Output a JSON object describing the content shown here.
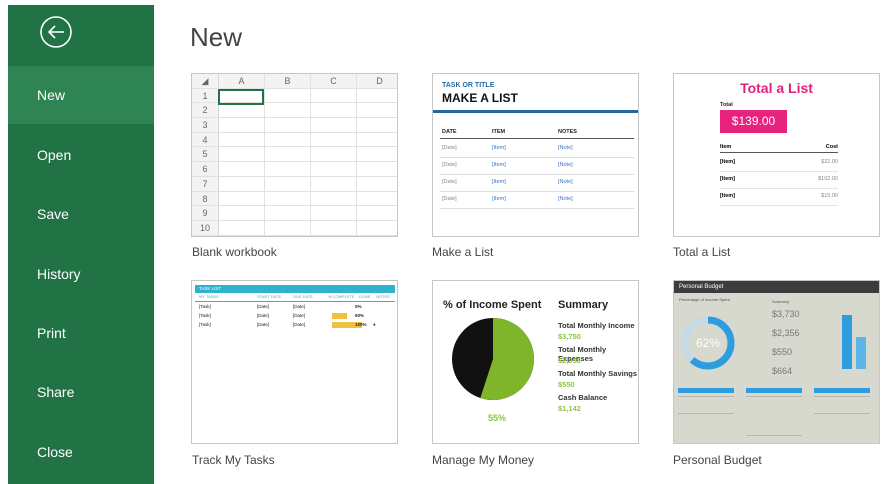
{
  "sidebar": {
    "back_label": "Back",
    "items": [
      {
        "label": "New",
        "active": true
      },
      {
        "label": "Open"
      },
      {
        "label": "Save"
      },
      {
        "label": "History"
      },
      {
        "label": "Print"
      },
      {
        "label": "Share"
      },
      {
        "label": "Close"
      }
    ],
    "colors": {
      "background": "#217346",
      "active": "#2f8454"
    }
  },
  "main": {
    "title": "New",
    "templates": [
      {
        "label": "Blank workbook"
      },
      {
        "label": "Make a List"
      },
      {
        "label": "Total a List"
      },
      {
        "label": "Track My Tasks"
      },
      {
        "label": "Manage My Money"
      },
      {
        "label": "Personal Budget"
      }
    ]
  },
  "blank_workbook": {
    "columns": [
      "A",
      "B",
      "C",
      "D"
    ],
    "rows": [
      "1",
      "2",
      "3",
      "4",
      "5",
      "6",
      "7",
      "8",
      "9",
      "10"
    ]
  },
  "make_a_list": {
    "eyebrow": "TASK OR TITLE",
    "heading": "MAKE A LIST",
    "columns": [
      "DATE",
      "ITEM",
      "NOTES"
    ],
    "rows": [
      [
        "[Date]",
        "[Item]",
        "[Note]"
      ],
      [
        "[Date]",
        "[Item]",
        "[Note]"
      ],
      [
        "[Date]",
        "[Item]",
        "[Note]"
      ],
      [
        "[Date]",
        "[Item]",
        "[Note]"
      ]
    ]
  },
  "total_a_list": {
    "heading": "Total a List",
    "total_label": "Total",
    "total_value": "$139.00",
    "columns": [
      "Item",
      "Cost"
    ],
    "rows": [
      [
        "[Item]",
        "$22.00"
      ],
      [
        "[Item]",
        "$102.00"
      ],
      [
        "[Item]",
        "$15.00"
      ]
    ]
  },
  "track_tasks": {
    "band": "TASK LIST",
    "headers": [
      "MY TASKS",
      "START DATE",
      "DUE DATE",
      "% COMPLETE",
      "DONE",
      "NOTES"
    ],
    "rows": [
      {
        "task": "[Task]",
        "start": "[Date]",
        "due": "[Date]",
        "pct": "0%",
        "fill": 0.0
      },
      {
        "task": "[Task]",
        "start": "[Date]",
        "due": "[Date]",
        "pct": "50%",
        "fill": 0.5
      },
      {
        "task": "[Task]",
        "start": "[Date]",
        "due": "[Date]",
        "pct": "100%",
        "fill": 1.0
      }
    ]
  },
  "manage_money": {
    "chart_title": "% of Income Spent",
    "pie_label": "55%",
    "spent_fraction": 0.55,
    "summary_title": "Summary",
    "lines": [
      {
        "label": "Total Monthly Income",
        "value": "$3,750"
      },
      {
        "label": "Total Monthly Expenses",
        "value": "$2,058"
      },
      {
        "label": "Total Monthly Savings",
        "value": "$550"
      },
      {
        "label": "Cash Balance",
        "value": "$1,142"
      }
    ]
  },
  "personal_budget": {
    "heading": "Personal Budget",
    "subheading": "Percentage of Income Spent",
    "donut_label": "62%",
    "donut_fraction": 0.62,
    "summary_title": "Summary",
    "values": [
      "$3,730",
      "$2,356",
      "$550",
      "$664"
    ]
  }
}
